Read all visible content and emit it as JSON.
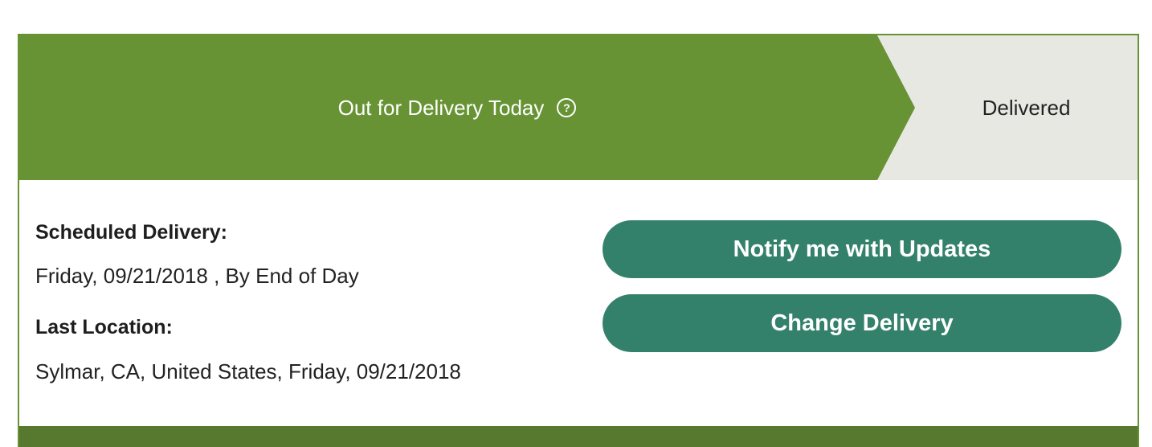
{
  "progress": {
    "current_step": "Out for Delivery Today",
    "next_step": "Delivered",
    "help_icon": "question-circle-icon",
    "colors": {
      "current": "#679334",
      "upcoming": "#e8e8e3"
    }
  },
  "details": {
    "scheduled_label": "Scheduled Delivery:",
    "scheduled_value": "Friday, 09/21/2018 , By End of Day",
    "location_label": "Last Location:",
    "location_value": "Sylmar, CA, United States, Friday, 09/21/2018"
  },
  "actions": {
    "notify_label": "Notify me with Updates",
    "change_label": "Change Delivery",
    "button_color": "#34816b"
  }
}
